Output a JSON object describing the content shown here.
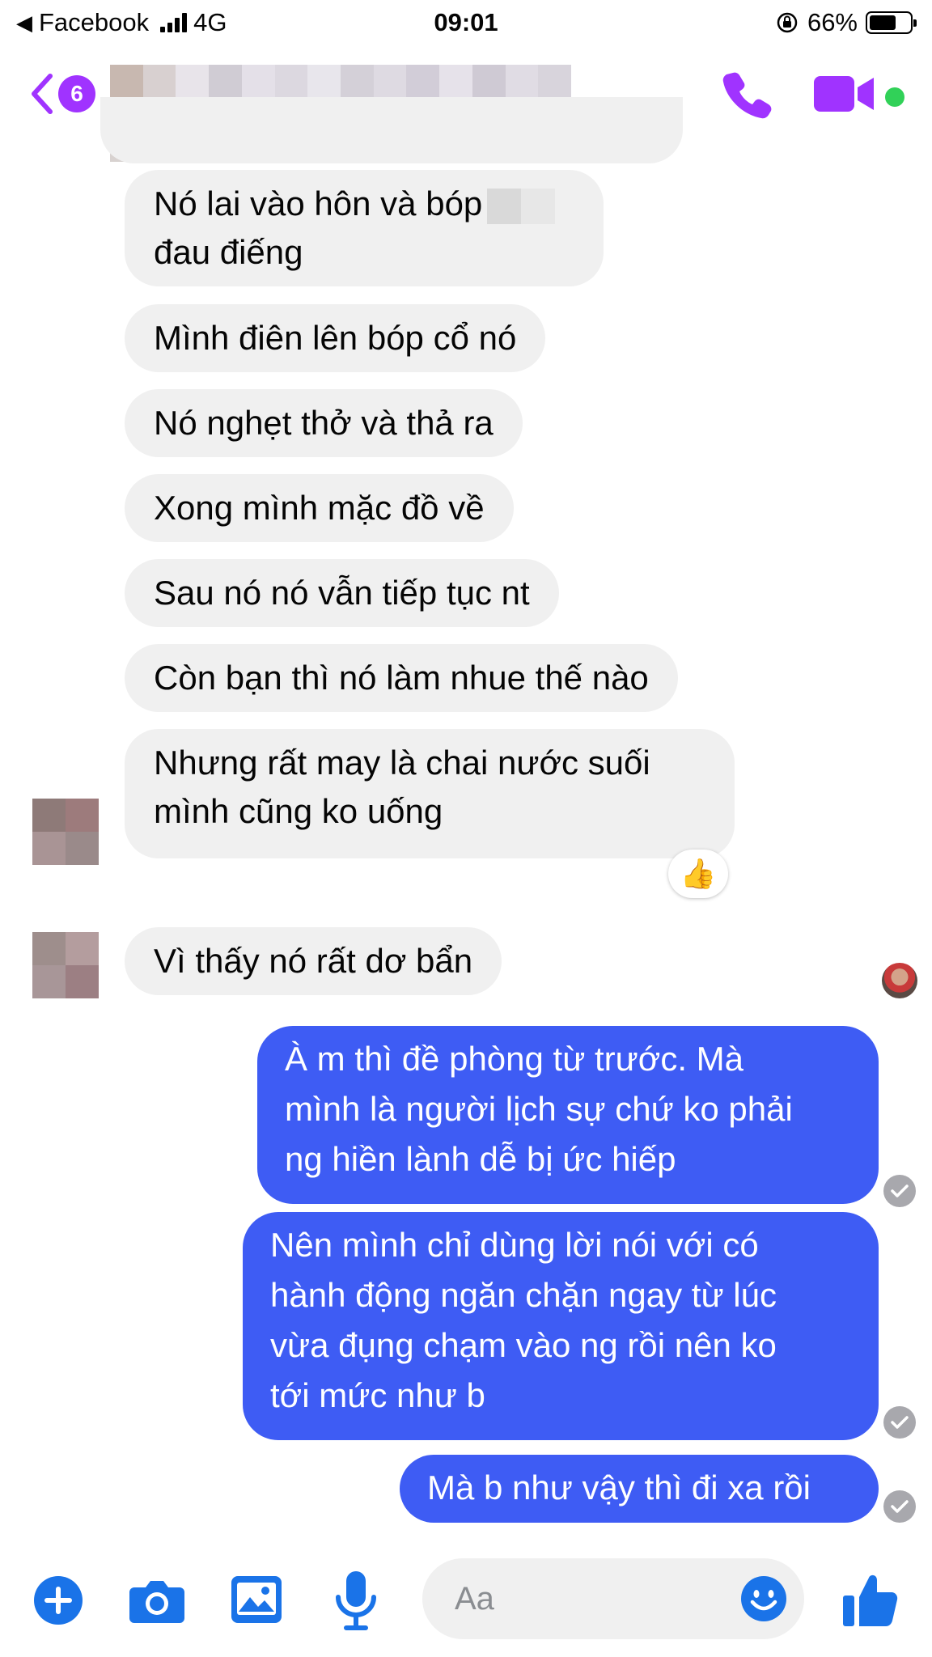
{
  "status_bar": {
    "back_app": "Facebook",
    "network": "4G",
    "time": "09:01",
    "battery": "66%",
    "battery_level": 0.66
  },
  "header": {
    "back_badge": "6",
    "contact_name_hidden": true,
    "icons": [
      "back-chevron-icon",
      "phone-icon",
      "video-camera-icon",
      "online-dot"
    ],
    "accent_color": "#a033ff"
  },
  "messages": {
    "incoming": [
      {
        "lines": [
          "Nó lai vào hôn và bóp",
          "đau điếng"
        ]
      },
      {
        "lines": [
          "Mình điên lên bóp cổ nó"
        ]
      },
      {
        "lines": [
          "Nó nghẹt thở và thả ra"
        ]
      },
      {
        "lines": [
          "Xong mình mặc đồ về"
        ]
      },
      {
        "lines": [
          "Sau nó nó vẫn tiếp tục nt"
        ]
      },
      {
        "lines": [
          "Còn bạn thì nó làm nhue thế nào"
        ]
      },
      {
        "lines": [
          "Nhưng rất may là chai nước suối",
          "mình cũng ko uống"
        ],
        "reaction": "👍"
      },
      {
        "lines": [
          "Vì thấy nó rất dơ bẩn"
        ]
      }
    ],
    "outgoing": [
      {
        "lines": [
          "À m thì đề phòng từ trước. Mà",
          "mình là người lịch sự chứ ko phải",
          "ng hiền lành dễ bị ức hiếp"
        ]
      },
      {
        "lines": [
          "Nên mình chỉ dùng lời nói với có",
          "hành động ngăn chặn ngay từ lúc",
          "vừa đụng chạm vào ng rồi nên ko",
          "tới mức như b"
        ]
      },
      {
        "lines": [
          "Mà b như vậy thì đi xa rồi"
        ]
      }
    ],
    "incoming_bubble_color": "#f0f0f0",
    "outgoing_bubble_color": "#3e5cf4"
  },
  "composer": {
    "placeholder": "Aa",
    "icons": [
      "plus-icon",
      "camera-icon",
      "image-icon",
      "microphone-icon",
      "emoji-icon",
      "like-thumb-icon"
    ],
    "icon_color": "#1a73e8"
  }
}
